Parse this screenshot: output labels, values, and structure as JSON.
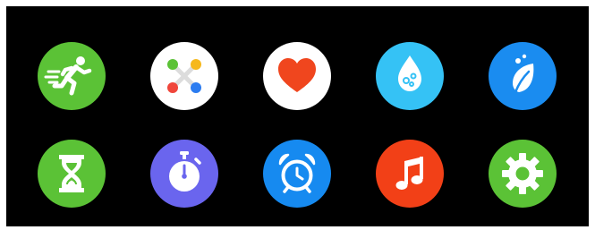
{
  "apps": [
    {
      "icon": "running-icon",
      "color": "#5BC236"
    },
    {
      "icon": "app-drawer-dots-icon",
      "color": "#FFFFFF"
    },
    {
      "icon": "heart-icon",
      "color": "#FFFFFF"
    },
    {
      "icon": "water-drop-icon",
      "color": "#35C2F5"
    },
    {
      "icon": "leaf-icon",
      "color": "#1A8CF0"
    },
    {
      "icon": "hourglass-icon",
      "color": "#5BC236"
    },
    {
      "icon": "stopwatch-icon",
      "color": "#6A65EE"
    },
    {
      "icon": "alarm-clock-icon",
      "color": "#168AF0"
    },
    {
      "icon": "music-note-icon",
      "color": "#F24017"
    },
    {
      "icon": "gear-icon",
      "color": "#5BC236"
    }
  ]
}
